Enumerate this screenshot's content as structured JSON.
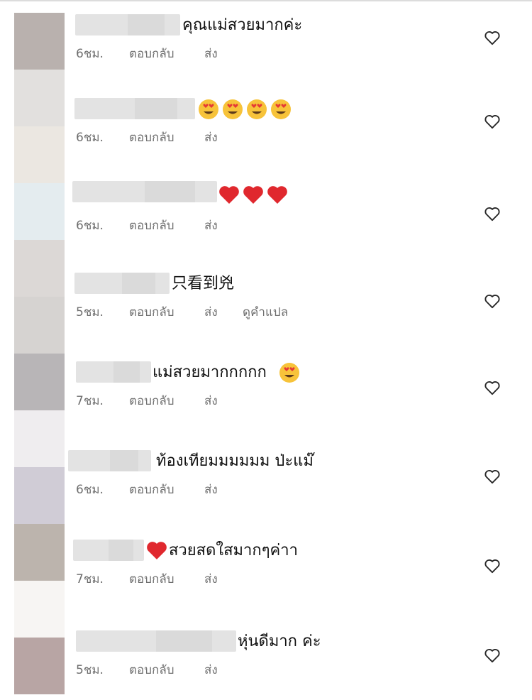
{
  "colors": {
    "avatar_blocks": [
      "#b9b1ae",
      "#e2e0de",
      "#ebe7e1",
      "#e4ecef",
      "#dcd8d6",
      "#d6d3d1",
      "#b8b5b7",
      "#efedef",
      "#d0ccd6",
      "#bcb4ad",
      "#f7f5f3",
      "#b8a5a4"
    ],
    "meta_text": "#6f6f6f",
    "heart_stroke": "#262626"
  },
  "comments": [
    {
      "text": "คุณแม่สวยมากค่ะ",
      "emojis": [],
      "time": "6ชม.",
      "reply": "ตอบกลับ",
      "send": "ส่ง",
      "translate": ""
    },
    {
      "text": "",
      "emojis": [
        "heart-eyes",
        "heart-eyes",
        "heart-eyes",
        "heart-eyes"
      ],
      "time": "6ชม.",
      "reply": "ตอบกลับ",
      "send": "ส่ง",
      "translate": ""
    },
    {
      "text": "",
      "emojis": [
        "red-heart",
        "red-heart",
        "red-heart"
      ],
      "time": "6ชม.",
      "reply": "ตอบกลับ",
      "send": "ส่ง",
      "translate": ""
    },
    {
      "text": "只看到兇",
      "emojis": [],
      "time": "5ชม.",
      "reply": "ตอบกลับ",
      "send": "ส่ง",
      "translate": "ดูคำแปล"
    },
    {
      "text": "แม่สวยมากกกกก",
      "emojis_after": [
        "heart-eyes"
      ],
      "time": "7ชม.",
      "reply": "ตอบกลับ",
      "send": "ส่ง",
      "translate": ""
    },
    {
      "text": "ท้องเทียมมมมมม ป่ะแม๊",
      "emojis": [],
      "time": "6ชม.",
      "reply": "ตอบกลับ",
      "send": "ส่ง",
      "translate": ""
    },
    {
      "text": "สวยสดใสมากๆค่าา",
      "emojis_before": [
        "red-heart"
      ],
      "time": "7ชม.",
      "reply": "ตอบกลับ",
      "send": "ส่ง",
      "translate": ""
    },
    {
      "text": "หุ่นดีมาก ค่ะ",
      "emojis": [],
      "time": "5ชม.",
      "reply": "ตอบกลับ",
      "send": "ส่ง",
      "translate": ""
    }
  ]
}
